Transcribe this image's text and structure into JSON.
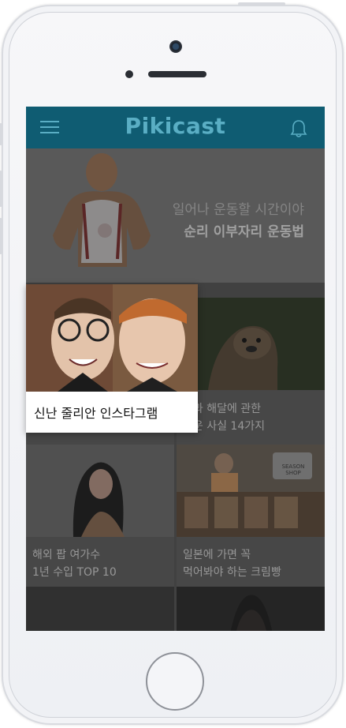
{
  "app": {
    "title": "Pikicast"
  },
  "icons": {
    "menu": "hamburger-menu-icon",
    "notifications": "bell-icon"
  },
  "colors": {
    "header_bg": "#0f5c72",
    "header_fg": "#5aaec4"
  },
  "banner": {
    "line1": "일어나 운동할 시간이야",
    "line2": "순리 이부자리 운동법"
  },
  "cards": [
    {
      "title_line1": "",
      "title_line2": ""
    },
    {
      "title_line1": "달과 해달에 관한",
      "title_line2": "여운 사실 14가지"
    },
    {
      "title_line1": "해외 팝 여가수",
      "title_line2": "1년 수입 TOP 10"
    },
    {
      "title_line1": "일본에 가면 꼭",
      "title_line2": "먹어봐야 하는 크림빵"
    }
  ],
  "popup": {
    "title": "신난 줄리안 인스타그램"
  },
  "shop_sign": "SEASON SHOP"
}
